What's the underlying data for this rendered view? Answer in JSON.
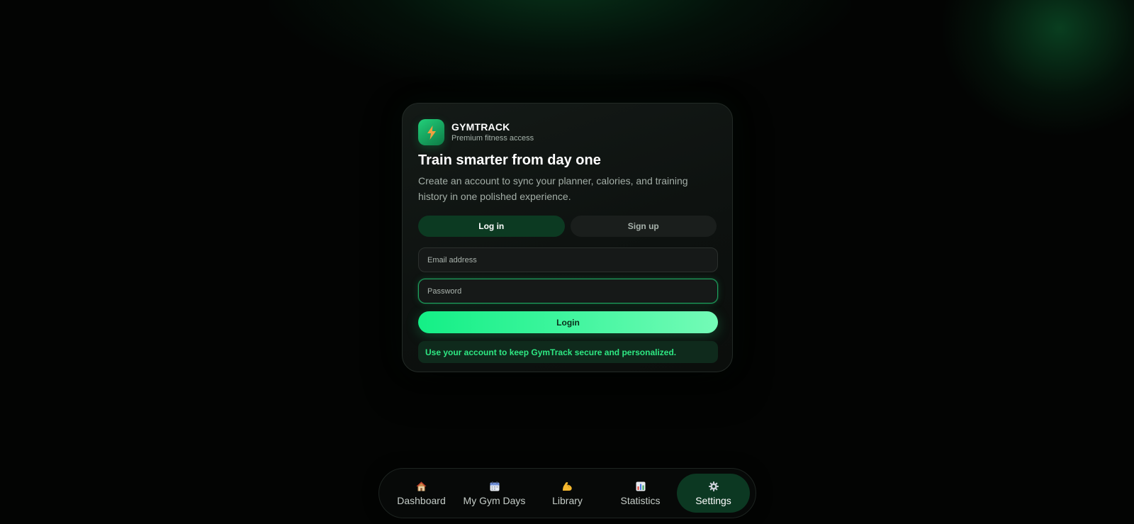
{
  "brand": {
    "name": "GYMTRACK",
    "tagline": "Premium fitness access"
  },
  "auth": {
    "headline": "Train smarter from day one",
    "description": "Create an account to sync your planner, calories, and training history in one polished experience.",
    "tabs": [
      {
        "label": "Log in",
        "active": true
      },
      {
        "label": "Sign up",
        "active": false
      }
    ],
    "email": {
      "placeholder": "Email address",
      "value": ""
    },
    "password": {
      "placeholder": "Password",
      "value": "",
      "focused": true
    },
    "submit_label": "Login",
    "notice": "Use your account to keep GymTrack secure and personalized."
  },
  "nav": {
    "items": [
      {
        "label": "Dashboard",
        "icon": "house-icon",
        "active": false
      },
      {
        "label": "My Gym Days",
        "icon": "calendar-icon",
        "active": false
      },
      {
        "label": "Library",
        "icon": "flexed-biceps-icon",
        "active": false
      },
      {
        "label": "Statistics",
        "icon": "bar-chart-icon",
        "active": false
      },
      {
        "label": "Settings",
        "icon": "gear-icon",
        "active": true
      }
    ]
  },
  "colors": {
    "accent": "#14ef86",
    "accent_light": "#74fbb7",
    "active_tab": "#0c3a22",
    "background": "#030403",
    "notice_text": "#2ee883"
  }
}
